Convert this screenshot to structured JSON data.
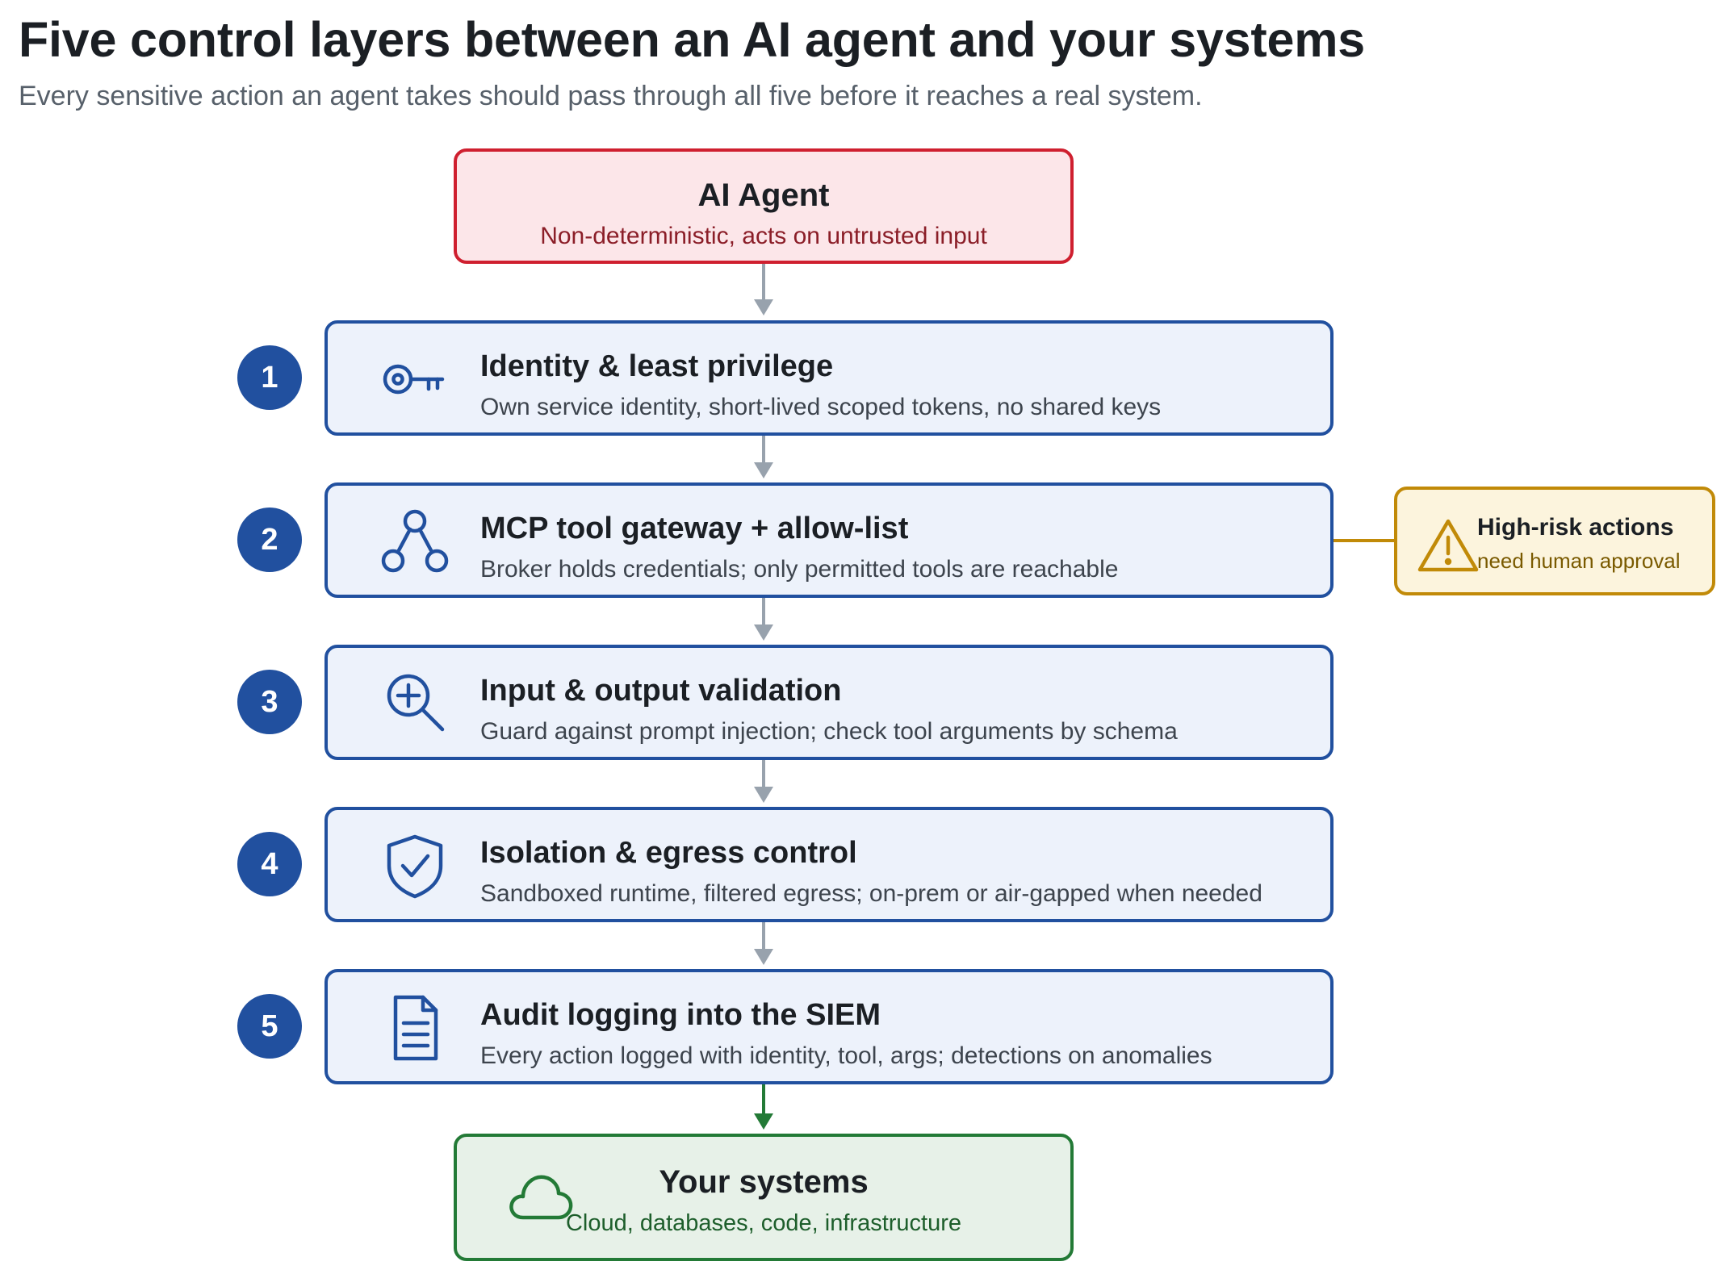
{
  "title": "Five control layers between an AI agent and your systems",
  "subtitle": "Every sensitive action an agent takes should pass through all five before it reaches a real system.",
  "agent": {
    "title": "AI Agent",
    "subtitle": "Non-deterministic, acts on untrusted input"
  },
  "layers": [
    {
      "number": "1",
      "icon": "key-icon",
      "title": "Identity & least privilege",
      "subtitle": "Own service identity, short-lived scoped tokens, no shared keys"
    },
    {
      "number": "2",
      "icon": "network-icon",
      "title": "MCP tool gateway + allow-list",
      "subtitle": "Broker holds credentials; only permitted tools are reachable"
    },
    {
      "number": "3",
      "icon": "magnifier-plus-icon",
      "title": "Input & output validation",
      "subtitle": "Guard against prompt injection; check tool arguments by schema"
    },
    {
      "number": "4",
      "icon": "shield-check-icon",
      "title": "Isolation & egress control",
      "subtitle": "Sandboxed runtime, filtered egress; on-prem or air-gapped when needed"
    },
    {
      "number": "5",
      "icon": "document-icon",
      "title": "Audit logging into the SIEM",
      "subtitle": "Every action logged with identity, tool, args; detections on anomalies"
    }
  ],
  "note": {
    "icon": "warning-icon",
    "title": "High-risk actions",
    "subtitle": "need human approval"
  },
  "systems": {
    "icon": "cloud-icon",
    "title": "Your systems",
    "subtitle": "Cloud, databases, code, infrastructure"
  },
  "colors": {
    "agent_border": "#cf1f2f",
    "agent_fill": "#fce6e9",
    "layer_border": "#21509f",
    "layer_fill": "#edf2fb",
    "note_border": "#c18a08",
    "note_fill": "#fcf4dd",
    "systems_border": "#237a36",
    "systems_fill": "#e7f1e8",
    "arrow_gray": "#98a2ad",
    "arrow_green": "#237a36"
  }
}
